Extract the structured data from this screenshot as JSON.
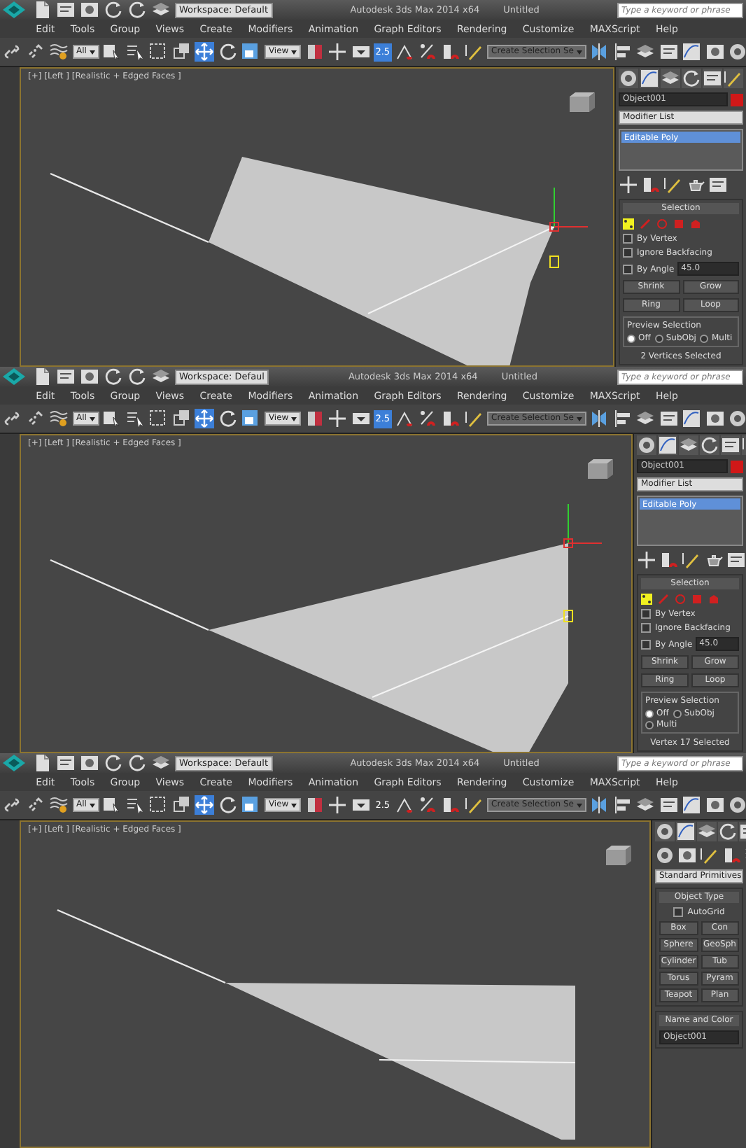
{
  "screens": [
    {
      "title_bar": {
        "workspace": "Workspace: Default",
        "app_title": "Autodesk 3ds Max  2014 x64",
        "document": "Untitled",
        "search_placeholder": "Type a keyword or phrase"
      },
      "menu": [
        "Edit",
        "Tools",
        "Group",
        "Views",
        "Create",
        "Modifiers",
        "Animation",
        "Graph Editors",
        "Rendering",
        "Customize",
        "MAXScript",
        "Help"
      ],
      "toolbar": {
        "selection_filter": "All",
        "move_selected": true,
        "reference_coord": "View",
        "snap": {
          "label": "2.5",
          "on": true
        },
        "named_selection": "Create Selection Se"
      },
      "viewport": {
        "label": "[+] [Left ] [Realistic + Edged Faces ]",
        "vertex_selected": true
      },
      "command_panel": {
        "kind": "modify",
        "object_name": "Object001",
        "modifier_list": "Modifier List",
        "stack": [
          {
            "label": "Editable Poly",
            "selected": true
          }
        ],
        "selection": {
          "title": "Selection",
          "levels": [
            {
              "kind": "vertex",
              "selected": true
            },
            {
              "kind": "edge",
              "selected": false
            },
            {
              "kind": "border",
              "selected": false
            },
            {
              "kind": "polygon",
              "selected": false
            },
            {
              "kind": "element",
              "selected": false
            }
          ],
          "options": [
            {
              "label": "By Vertex",
              "checked": false
            },
            {
              "label": "Ignore Backfacing",
              "checked": false
            },
            {
              "label": "By Angle",
              "checked": false,
              "value": "45.0"
            }
          ],
          "buttons": [
            "Shrink",
            "Grow"
          ],
          "spinners": [
            "Ring",
            "Loop"
          ],
          "preview": {
            "title": "Preview Selection",
            "options": [
              {
                "label": "Off",
                "selected": true
              },
              {
                "label": "SubObj",
                "selected": false
              },
              {
                "label": "Multi",
                "selected": false
              }
            ]
          },
          "status": "2 Vertices Selected"
        }
      }
    },
    {
      "title_bar": {
        "workspace": "Workspace: Defaul",
        "app_title": "Autodesk 3ds Max  2014 x64",
        "document": "Untitled",
        "search_placeholder": "Type a keyword or phrase"
      },
      "menu": [
        "Edit",
        "Tools",
        "Group",
        "Views",
        "Create",
        "Modifiers",
        "Animation",
        "Graph Editors",
        "Rendering",
        "Customize",
        "MAXScript",
        "Help"
      ],
      "toolbar": {
        "selection_filter": "All",
        "move_selected": true,
        "reference_coord": "View",
        "snap": {
          "label": "2.5",
          "on": true
        },
        "named_selection": "Create Selection Se"
      },
      "viewport": {
        "label": "[+] [Left ] [Realistic + Edged Faces ]",
        "vertex_selected": true
      },
      "command_panel": {
        "kind": "modify",
        "object_name": "Object001",
        "modifier_list": "Modifier List",
        "stack": [
          {
            "label": "Editable Poly",
            "selected": true
          }
        ],
        "selection": {
          "title": "Selection",
          "levels": [
            {
              "kind": "vertex",
              "selected": true
            },
            {
              "kind": "edge",
              "selected": false
            },
            {
              "kind": "border",
              "selected": false
            },
            {
              "kind": "polygon",
              "selected": false
            },
            {
              "kind": "element",
              "selected": false
            }
          ],
          "options": [
            {
              "label": "By Vertex",
              "checked": false
            },
            {
              "label": "Ignore Backfacing",
              "checked": false
            },
            {
              "label": "By Angle",
              "checked": false,
              "value": "45.0"
            }
          ],
          "buttons": [
            "Shrink",
            "Grow"
          ],
          "spinners": [
            "Ring",
            "Loop"
          ],
          "preview": {
            "title": "Preview Selection",
            "options": [
              {
                "label": "Off",
                "selected": true
              },
              {
                "label": "SubObj",
                "selected": false
              },
              {
                "label": "Multi",
                "selected": false
              }
            ]
          },
          "status": "Vertex 17 Selected"
        }
      }
    },
    {
      "title_bar": {
        "workspace": "Workspace: Default",
        "app_title": "Autodesk 3ds Max  2014 x64",
        "document": "Untitled",
        "search_placeholder": "Type a keyword or phrase"
      },
      "menu": [
        "Edit",
        "Tools",
        "Group",
        "Views",
        "Create",
        "Modifiers",
        "Animation",
        "Graph Editors",
        "Rendering",
        "Customize",
        "MAXScript",
        "Help"
      ],
      "toolbar": {
        "selection_filter": "All",
        "move_selected": true,
        "reference_coord": "View",
        "snap": {
          "label": "2.5",
          "on": false
        },
        "named_selection": "Create Selection Se"
      },
      "viewport": {
        "label": "[+] [Left ] [Realistic + Edged Faces ]",
        "vertex_selected": false
      },
      "command_panel": {
        "kind": "create",
        "category": "Standard Primitives",
        "object_type": {
          "title": "Object Type",
          "autogrid": {
            "label": "AutoGrid",
            "checked": false
          },
          "buttons": [
            "Box",
            "Con",
            "Sphere",
            "GeoSph",
            "Cylinder",
            "Tub",
            "Torus",
            "Pyram",
            "Teapot",
            "Plan"
          ]
        },
        "name_and_color": {
          "title": "Name and Color",
          "name": "Object001"
        }
      }
    }
  ]
}
